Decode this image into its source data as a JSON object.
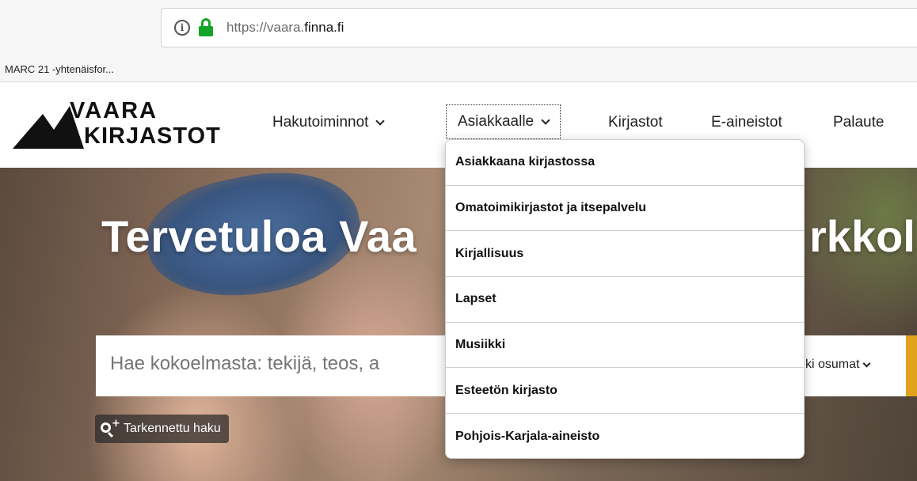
{
  "browser": {
    "url_prefix": "https://vaara.",
    "url_domain": "finna.fi",
    "bookmark": "MARC 21 -yhtenäisfor..."
  },
  "logo": {
    "line1": "VAARA",
    "line2": "KIRJASTOT"
  },
  "nav": [
    {
      "label": "Hakutoiminnot",
      "has_dropdown": true
    },
    {
      "label": "Asiakkaalle",
      "has_dropdown": true,
      "active": true
    },
    {
      "label": "Kirjastot"
    },
    {
      "label": "E-aineistot"
    },
    {
      "label": "Palaute"
    }
  ],
  "hero": {
    "title_left": "Tervetuloa Vaa",
    "title_right": "rkkol"
  },
  "search": {
    "placeholder": "Hae kokoelmasta: tekijä, teos, a",
    "scope_label": "ki osumat"
  },
  "advanced_search": "Tarkennettu haku",
  "dropdown": [
    "Asiakkaana kirjastossa",
    "Omatoimikirjastot ja itsepalvelu",
    "Kirjallisuus",
    "Lapset",
    "Musiikki",
    "Esteetön kirjasto",
    "Pohjois-Karjala-aineisto"
  ],
  "colors": {
    "lock": "#14a52a",
    "search_button": "#e0a31b"
  },
  "icons": [
    "info-icon",
    "lock-icon",
    "chevron-down-icon",
    "search-plus-icon"
  ]
}
